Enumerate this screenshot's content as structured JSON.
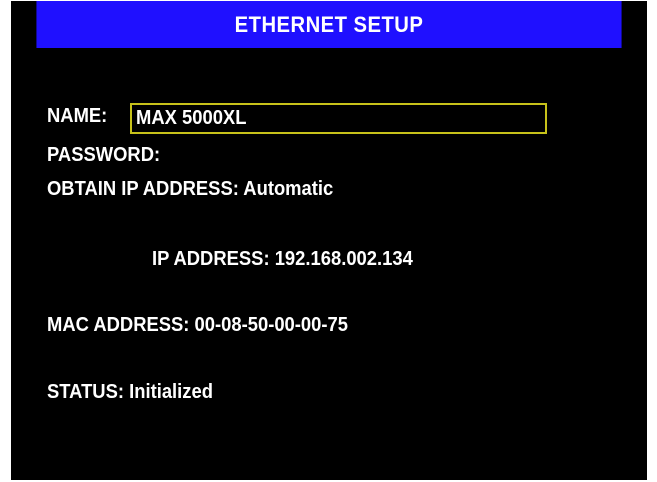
{
  "title": "ETHERNET SETUP",
  "fields": {
    "name_label": "NAME:",
    "name_value": "MAX 5000XL",
    "password_label": "PASSWORD:",
    "password_value": "",
    "obtain_label": "OBTAIN IP ADDRESS:",
    "obtain_value": "Automatic",
    "ip_label": "IP ADDRESS:",
    "ip_value": "192.168.002.134",
    "mac_label": "MAC ADDRESS:",
    "mac_value": "00-08-50-00-00-75",
    "status_label": "STATUS:",
    "status_value": "Initialized"
  },
  "colors": {
    "title_bar": "#1f10ff",
    "background": "#000000",
    "text": "#ffffff",
    "focus_border": "#c7c21a"
  }
}
